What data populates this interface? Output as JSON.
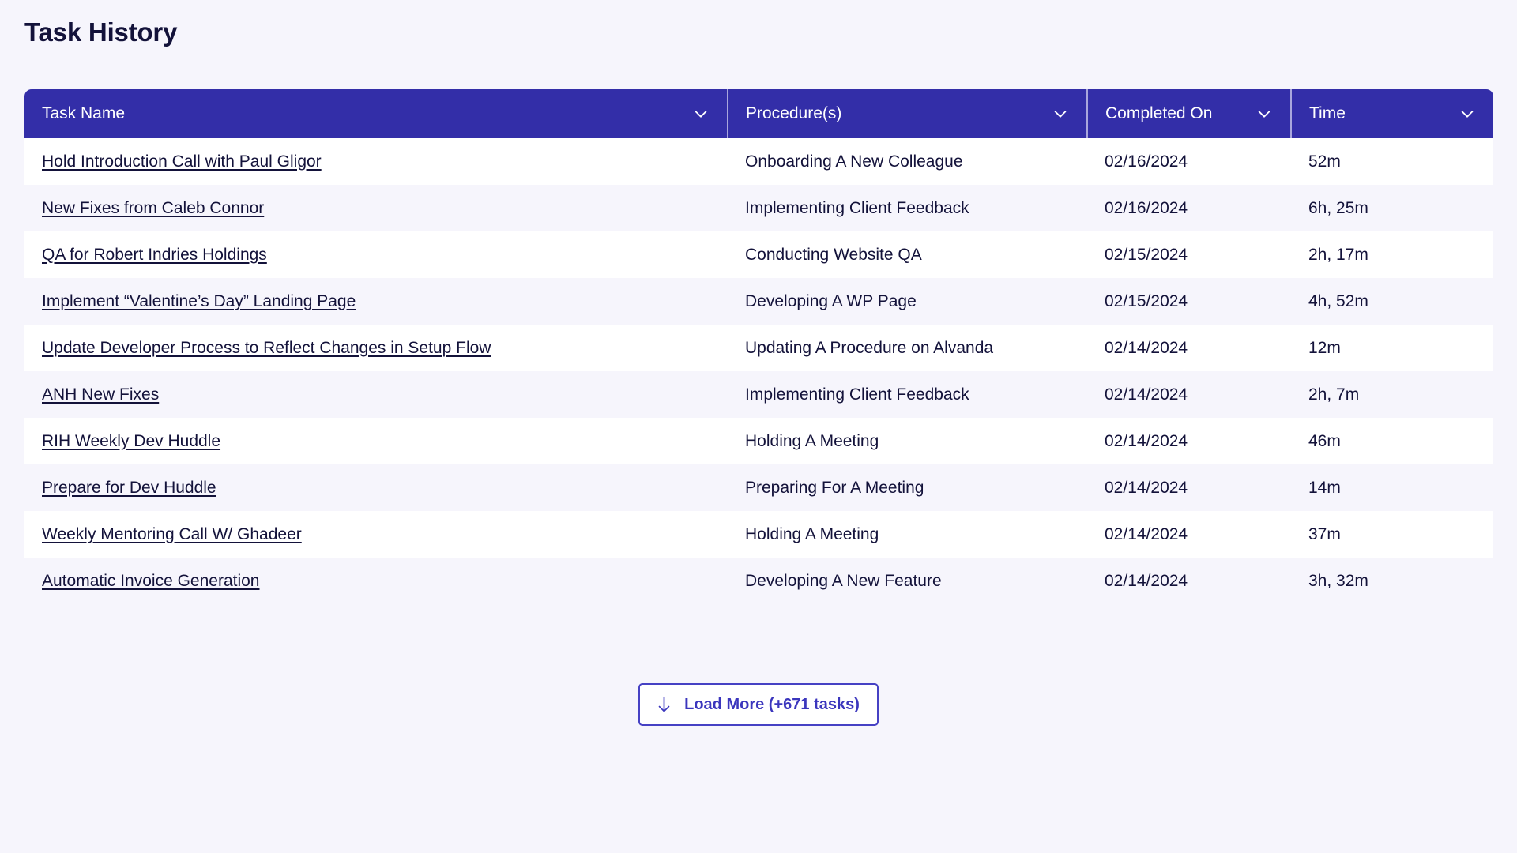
{
  "page": {
    "title": "Task History",
    "background_color": "#f6f5fc",
    "accent_color": "#332ea8",
    "text_color": "#13123a"
  },
  "table": {
    "columns": [
      {
        "label": "Task Name",
        "sort_icon": "chevron-down-icon"
      },
      {
        "label": "Procedure(s)",
        "sort_icon": "chevron-down-icon"
      },
      {
        "label": "Completed On",
        "sort_icon": "chevron-down-icon"
      },
      {
        "label": "Time",
        "sort_icon": "chevron-down-icon"
      }
    ],
    "rows": [
      {
        "task_name": "Hold Introduction Call with Paul Gligor",
        "procedure": "Onboarding A New Colleague",
        "completed_on": "02/16/2024",
        "time": "52m"
      },
      {
        "task_name": "New Fixes from Caleb Connor",
        "procedure": "Implementing Client Feedback",
        "completed_on": "02/16/2024",
        "time": "6h, 25m"
      },
      {
        "task_name": "QA for Robert Indries Holdings",
        "procedure": "Conducting Website QA",
        "completed_on": "02/15/2024",
        "time": "2h, 17m"
      },
      {
        "task_name": "Implement “Valentine’s Day” Landing Page",
        "procedure": "Developing A WP Page",
        "completed_on": "02/15/2024",
        "time": "4h, 52m"
      },
      {
        "task_name": "Update Developer Process to Reflect Changes in Setup Flow",
        "procedure": "Updating A Procedure on Alvanda",
        "completed_on": "02/14/2024",
        "time": "12m"
      },
      {
        "task_name": "ANH New Fixes",
        "procedure": "Implementing Client Feedback",
        "completed_on": "02/14/2024",
        "time": "2h, 7m"
      },
      {
        "task_name": "RIH Weekly Dev Huddle",
        "procedure": "Holding A Meeting",
        "completed_on": "02/14/2024",
        "time": "46m"
      },
      {
        "task_name": "Prepare for Dev Huddle",
        "procedure": "Preparing For A Meeting",
        "completed_on": "02/14/2024",
        "time": "14m"
      },
      {
        "task_name": "Weekly Mentoring Call W/ Ghadeer",
        "procedure": "Holding A Meeting",
        "completed_on": "02/14/2024",
        "time": "37m"
      },
      {
        "task_name": "Automatic Invoice Generation",
        "procedure": "Developing A New Feature",
        "completed_on": "02/14/2024",
        "time": "3h, 32m"
      }
    ]
  },
  "footer": {
    "load_more_label": "Load More (+671 tasks)",
    "load_more_icon": "arrow-down-icon"
  }
}
